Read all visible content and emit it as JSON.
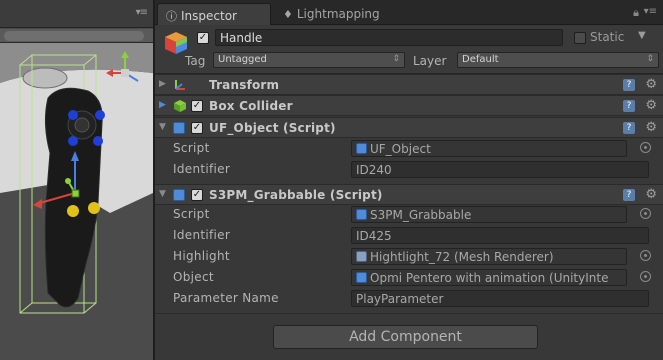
{
  "inspector": {
    "tabs": [
      {
        "label": "Inspector",
        "icon": "info-icon"
      },
      {
        "label": "Lightmapping",
        "icon": "bulb-icon"
      }
    ],
    "object": {
      "name": "Handle",
      "static_label": "Static",
      "tag_label": "Tag",
      "tag_value": "Untagged",
      "layer_label": "Layer",
      "layer_value": "Default"
    },
    "components": [
      {
        "title": "Transform",
        "expanded": false,
        "has_checkbox": false
      },
      {
        "title": "Box Collider",
        "expanded": false,
        "has_checkbox": true
      },
      {
        "title": "UF_Object (Script)",
        "expanded": true,
        "has_checkbox": true,
        "properties": [
          {
            "label": "Script",
            "value": "UF_Object",
            "ref": "script"
          },
          {
            "label": "Identifier",
            "value": "ID240"
          }
        ]
      },
      {
        "title": "S3PM_Grabbable (Script)",
        "expanded": true,
        "has_checkbox": true,
        "properties": [
          {
            "label": "Script",
            "value": "S3PM_Grabbable",
            "ref": "script"
          },
          {
            "label": "Identifier",
            "value": "ID425"
          },
          {
            "label": "Highlight",
            "value": "Hightlight_72 (Mesh Renderer)",
            "ref": "mesh"
          },
          {
            "label": "Object",
            "value": "Opmi Pentero with animation (UnityInte",
            "ref": "script"
          },
          {
            "label": "Parameter Name",
            "value": "PlayParameter"
          }
        ]
      }
    ],
    "add_component_label": "Add Component"
  },
  "colors": {
    "panel_bg": "#383838",
    "scene_bg": "#4a4a4a",
    "accent_blue": "#4f8bd6",
    "gizmo_red": "#d9433a",
    "gizmo_green": "#8ad13b",
    "gizmo_blue": "#4a7fe6",
    "marker_yellow": "#e0c21a"
  }
}
